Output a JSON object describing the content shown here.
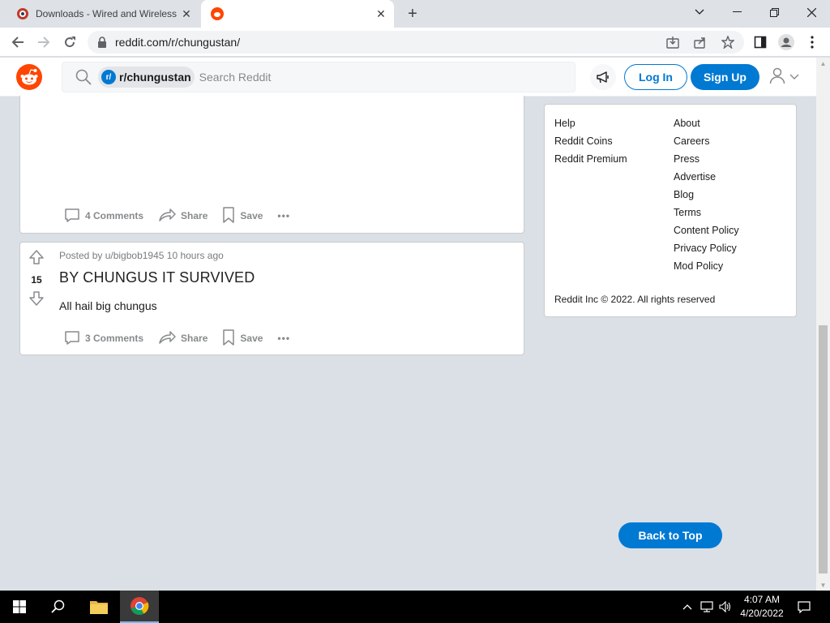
{
  "browser": {
    "tabs": [
      {
        "title": "Downloads - Wired and Wireless",
        "close": "✕"
      },
      {
        "title": "",
        "close": "✕"
      }
    ],
    "new_tab": "+",
    "url": "reddit.com/r/chungustan/"
  },
  "reddit_header": {
    "subreddit_chip": "r/chungustan",
    "chip_icon_text": "r/",
    "search_placeholder": "Search Reddit",
    "login_label": "Log In",
    "signup_label": "Sign Up"
  },
  "posts": [
    {
      "comments_label": "4 Comments",
      "share_label": "Share",
      "save_label": "Save",
      "more": "•••"
    },
    {
      "votes": "15",
      "meta": "Posted by u/bigbob1945 10 hours ago",
      "title": "BY CHUNGUS IT SURVIVED",
      "body": "All hail big chungus",
      "comments_label": "3 Comments",
      "share_label": "Share",
      "save_label": "Save",
      "more": "•••"
    }
  ],
  "sidebar": {
    "col1": [
      "Help",
      "Reddit Coins",
      "Reddit Premium"
    ],
    "col2": [
      "About",
      "Careers",
      "Press",
      "Advertise",
      "Blog",
      "Terms",
      "Content Policy",
      "Privacy Policy",
      "Mod Policy"
    ],
    "copyright": "Reddit Inc © 2022. All rights reserved"
  },
  "back_to_top": "Back to Top",
  "taskbar": {
    "time": "4:07 AM",
    "date": "4/20/2022"
  },
  "colors": {
    "reddit_orange": "#ff4500",
    "reddit_blue": "#0079d3",
    "page_bg": "#dae0e6"
  }
}
